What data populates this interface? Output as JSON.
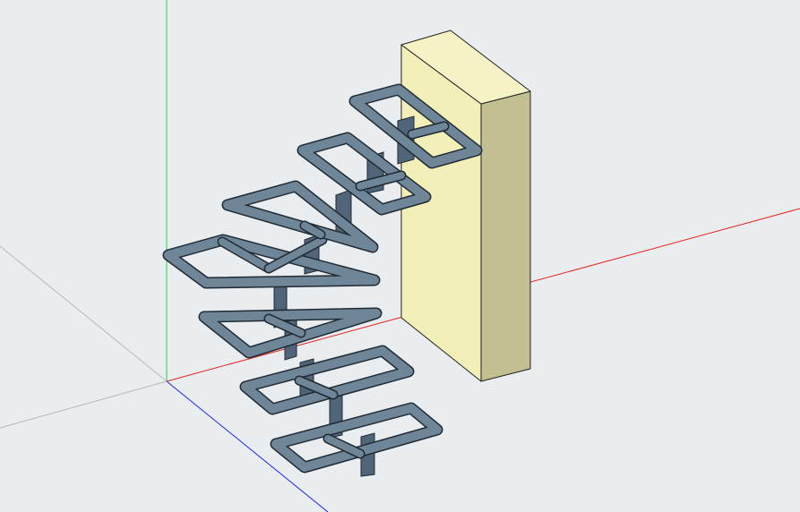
{
  "scene": {
    "background": "#e9edef",
    "axis_colors": {
      "x": "#e8221f",
      "y": "#2fd146",
      "z": "#1e24e6",
      "guide": "#b5b8ba"
    },
    "wall_colors": {
      "front": "#f3efb9",
      "side": "#c2bf91",
      "top": "#f5f2c6",
      "edge": "#222222"
    },
    "frame_colors": {
      "top": "#6f8598",
      "side": "#4a5d6e",
      "outline": "#1f2a33"
    }
  }
}
